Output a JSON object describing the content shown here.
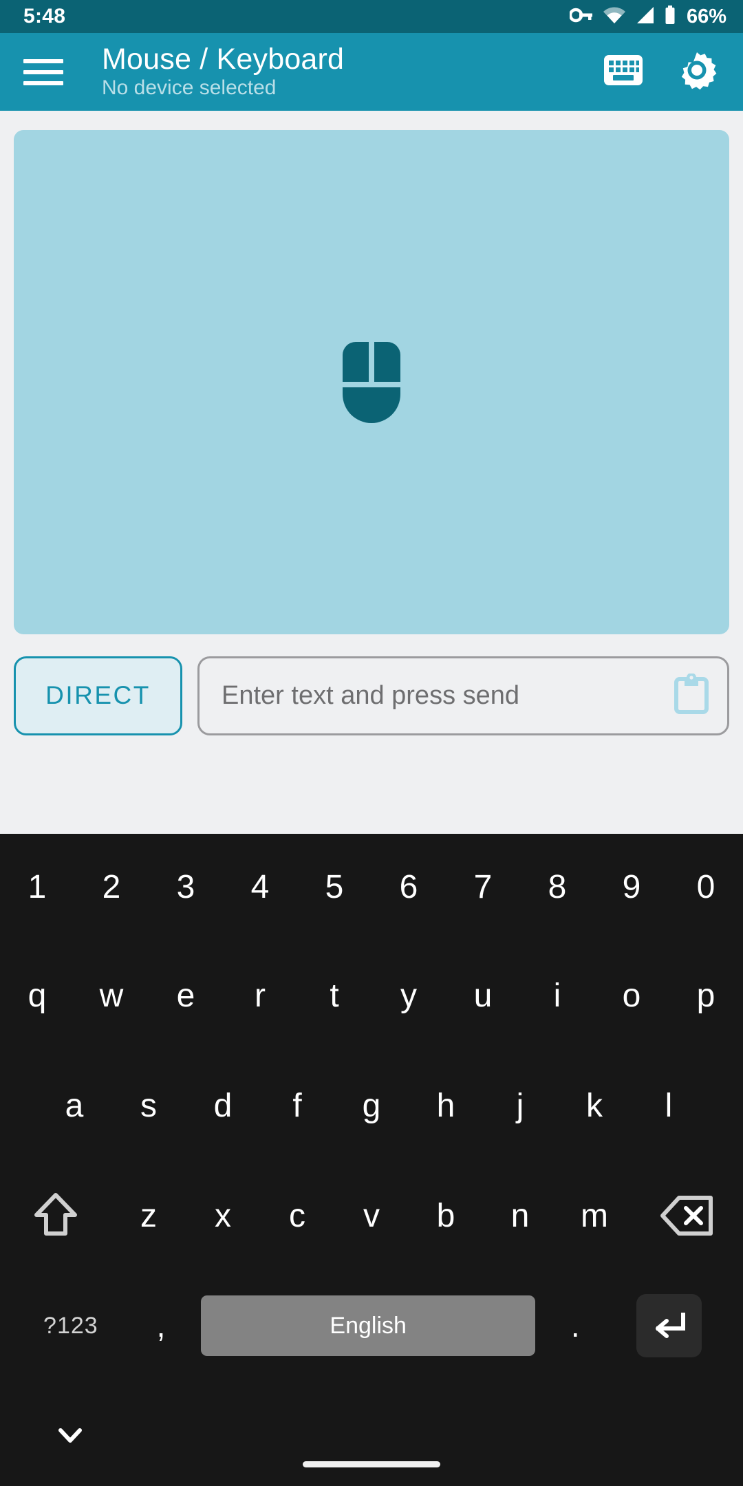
{
  "status_bar": {
    "time": "5:48",
    "battery_text": "66%",
    "icons": [
      "key-icon",
      "wifi-icon",
      "cell-signal-icon",
      "battery-icon"
    ],
    "background": "#0b6374"
  },
  "app_bar": {
    "menu_icon": "hamburger-menu-icon",
    "title": "Mouse / Keyboard",
    "subtitle": "No device selected",
    "actions": [
      "keyboard-icon",
      "gear-icon"
    ],
    "background": "#1792ae"
  },
  "touchpad": {
    "icon": "mouse-icon",
    "background": "#a2d5e2",
    "icon_color": "#0b6374"
  },
  "input_row": {
    "direct_button_label": "DIRECT",
    "direct_button_accent": "#1792ae",
    "text_input_value": "",
    "text_input_placeholder": "Enter text and press send",
    "paste_icon": "clipboard-icon",
    "paste_icon_color": "#a9d9e8"
  },
  "keyboard": {
    "background": "#171717",
    "row_numbers": [
      "1",
      "2",
      "3",
      "4",
      "5",
      "6",
      "7",
      "8",
      "9",
      "0"
    ],
    "row_top": [
      "q",
      "w",
      "e",
      "r",
      "t",
      "y",
      "u",
      "i",
      "o",
      "p"
    ],
    "row_home": [
      "a",
      "s",
      "d",
      "f",
      "g",
      "h",
      "j",
      "k",
      "l"
    ],
    "row_bottom": [
      "z",
      "x",
      "c",
      "v",
      "b",
      "n",
      "m"
    ],
    "shift_key": "shift-key-icon",
    "backspace_key": "backspace-key-icon",
    "symbols_key_label": "?123",
    "comma_key_label": ",",
    "space_key_label": "English",
    "space_key_color": "#838383",
    "period_key_label": ".",
    "enter_key": "enter-key-icon",
    "enter_key_color": "#2b2b2b"
  },
  "nav_bar": {
    "hide_keyboard_icon": "chevron-down-icon",
    "home_indicator": "home-pill-indicator",
    "background": "#171717"
  }
}
